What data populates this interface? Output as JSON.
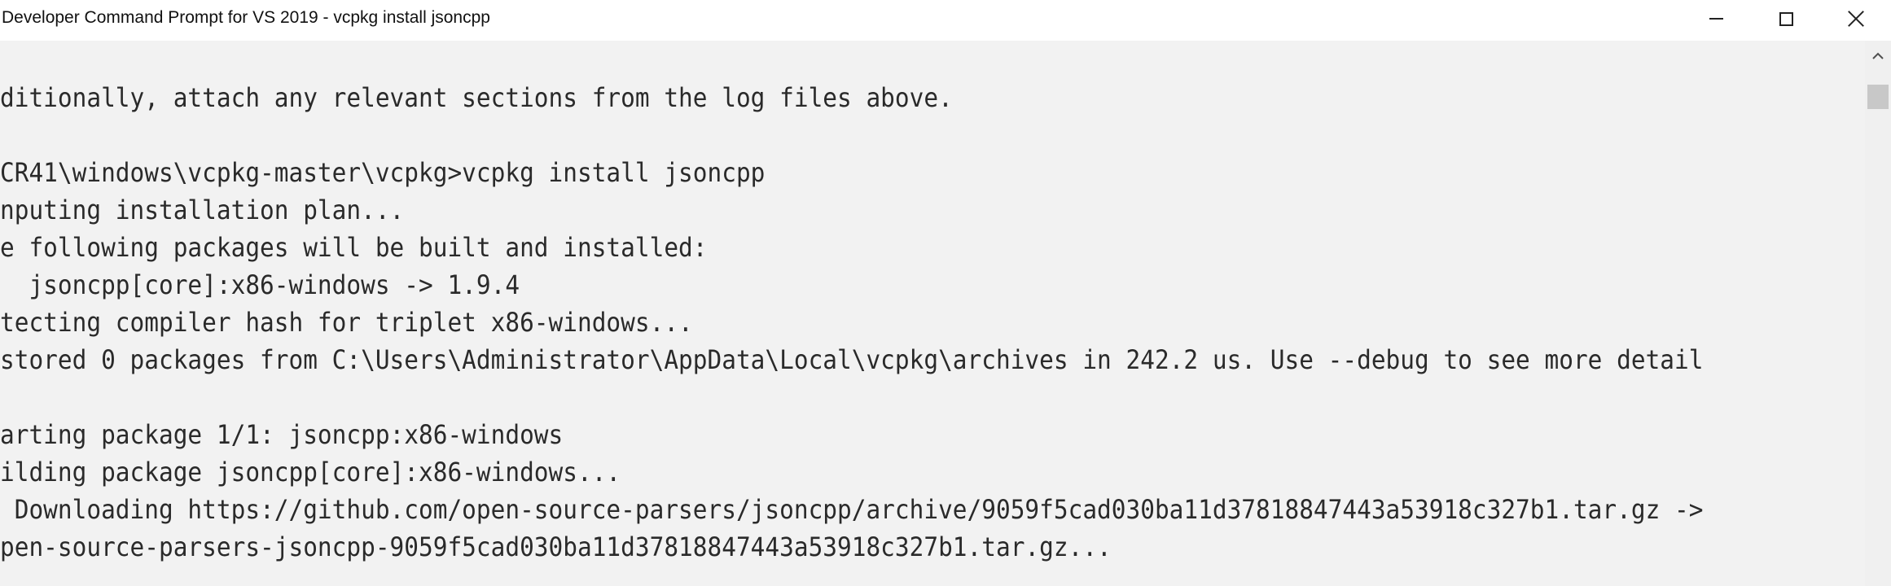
{
  "window": {
    "title": "Developer Command Prompt for VS 2019 - vcpkg  install jsoncpp"
  },
  "console": {
    "lines": [
      "ditionally, attach any relevant sections from the log files above.",
      "",
      "CR41\\windows\\vcpkg-master\\vcpkg>vcpkg install jsoncpp",
      "nputing installation plan...",
      "e following packages will be built and installed:",
      "  jsoncpp[core]:x86-windows -> 1.9.4",
      "tecting compiler hash for triplet x86-windows...",
      "stored 0 packages from C:\\Users\\Administrator\\AppData\\Local\\vcpkg\\archives in 242.2 us. Use --debug to see more detail",
      "",
      "arting package 1/1: jsoncpp:x86-windows",
      "ilding package jsoncpp[core]:x86-windows...",
      " Downloading https://github.com/open-source-parsers/jsoncpp/archive/9059f5cad030ba11d37818847443a53918c327b1.tar.gz ->",
      "pen-source-parsers-jsoncpp-9059f5cad030ba11d37818847443a53918c327b1.tar.gz..."
    ]
  },
  "icons": {
    "minimize": "minimize-icon",
    "maximize": "maximize-icon",
    "close": "close-icon",
    "scroll_up": "chevron-up-icon"
  },
  "colors": {
    "titlebar": "#ffffff",
    "console_background": "#f2f2f2",
    "console_text": "#2a2a2a"
  }
}
